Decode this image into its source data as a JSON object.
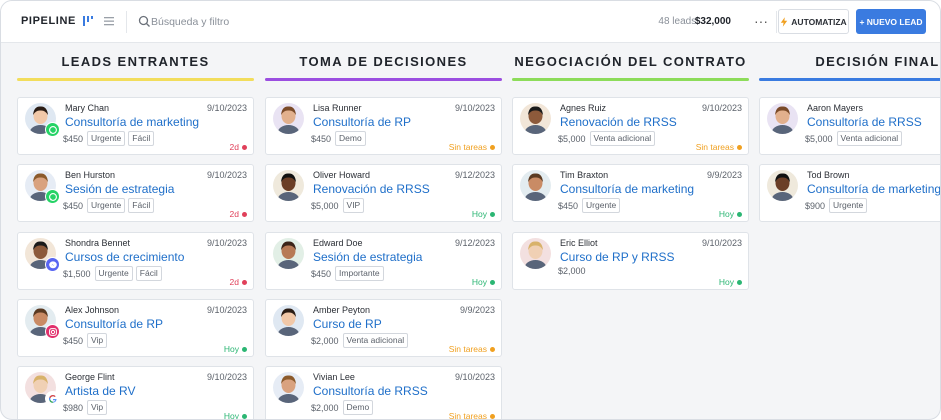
{
  "header": {
    "brand": "PIPELINE",
    "search_placeholder": "Búsqueda y filtro",
    "leads_count": "48 leads:",
    "leads_total": "$32,000",
    "more_label": "···",
    "automate_label": "AUTOMATIZA",
    "new_lead_label": "+ NUEVO LEAD"
  },
  "colors": {
    "accent_blue": "#3a7be0",
    "link_blue": "#1f6fc9",
    "overdue_red": "#e0405a",
    "no_tasks_orange": "#f0a020",
    "today_green": "#2bb673"
  },
  "columns": [
    {
      "title": "LEADS ENTRANTES",
      "color": "#f2dd5c",
      "cards": [
        {
          "name": "Mary Chan",
          "date": "9/10/2023",
          "title": "Consultoría de marketing",
          "price": "$450",
          "tags": [
            "Urgente",
            "Fácil"
          ],
          "status": "2d",
          "status_type": "overdue",
          "source": "whatsapp"
        },
        {
          "name": "Ben Hurston",
          "date": "9/10/2023",
          "title": "Sesión de estrategia",
          "price": "$450",
          "tags": [
            "Urgente",
            "Fácil"
          ],
          "status": "2d",
          "status_type": "overdue",
          "source": "whatsapp"
        },
        {
          "name": "Shondra Bennet",
          "date": "9/10/2023",
          "title": "Cursos de crecimiento",
          "price": "$1,500",
          "tags": [
            "Urgente",
            "Fácil"
          ],
          "status": "2d",
          "status_type": "overdue",
          "source": "messenger"
        },
        {
          "name": "Alex Johnson",
          "date": "9/10/2023",
          "title": "Consultoría de RP",
          "price": "$450",
          "tags": [
            "Vip"
          ],
          "status": "Hoy",
          "status_type": "today",
          "source": "instagram"
        },
        {
          "name": "George Flint",
          "date": "9/10/2023",
          "title": "Artista de RV",
          "price": "$980",
          "tags": [
            "Vip"
          ],
          "status": "Hoy",
          "status_type": "today",
          "source": "google"
        }
      ]
    },
    {
      "title": "TOMA DE DECISIONES",
      "color": "#9b4ee0",
      "cards": [
        {
          "name": "Lisa Runner",
          "date": "9/10/2023",
          "title": "Consultoría de RP",
          "price": "$450",
          "tags": [
            "Demo"
          ],
          "status": "Sin tareas",
          "status_type": "notasks",
          "source": ""
        },
        {
          "name": "Oliver Howard",
          "date": "9/12/2023",
          "title": "Renovación de RRSS",
          "price": "$5,000",
          "tags": [
            "VIP"
          ],
          "status": "Hoy",
          "status_type": "today",
          "source": ""
        },
        {
          "name": "Edward Doe",
          "date": "9/12/2023",
          "title": "Sesión de estrategia",
          "price": "$450",
          "tags": [
            "Importante"
          ],
          "status": "Hoy",
          "status_type": "today",
          "source": ""
        },
        {
          "name": "Amber Peyton",
          "date": "9/9/2023",
          "title": "Curso de RP",
          "price": "$2,000",
          "tags": [
            "Venta adicional"
          ],
          "status": "Sin tareas",
          "status_type": "notasks",
          "source": ""
        },
        {
          "name": "Vivian Lee",
          "date": "9/10/2023",
          "title": "Consultoría de RRSS",
          "price": "$2,000",
          "tags": [
            "Demo"
          ],
          "status": "Sin tareas",
          "status_type": "notasks",
          "source": ""
        }
      ]
    },
    {
      "title": "NEGOCIACIÓN DEL CONTRATO",
      "color": "#8ddc5a",
      "cards": [
        {
          "name": "Agnes Ruiz",
          "date": "9/10/2023",
          "title": "Renovación de RRSS",
          "price": "$5,000",
          "tags": [
            "Venta adicional"
          ],
          "status": "Sin tareas",
          "status_type": "notasks",
          "source": ""
        },
        {
          "name": "Tim Braxton",
          "date": "9/9/2023",
          "title": "Consultoría de marketing",
          "price": "$450",
          "tags": [
            "Urgente"
          ],
          "status": "Hoy",
          "status_type": "today",
          "source": ""
        },
        {
          "name": "Eric Elliot",
          "date": "9/10/2023",
          "title": "Curso de RP y RRSS",
          "price": "$2,000",
          "tags": [],
          "status": "Hoy",
          "status_type": "today",
          "source": ""
        }
      ]
    },
    {
      "title": "DECISIÓN FINAL",
      "color": "#3a7be0",
      "cards": [
        {
          "name": "Aaron Mayers",
          "date": "",
          "title": "Consultoría de RRSS",
          "price": "$5,000",
          "tags": [
            "Venta adicional"
          ],
          "status": "",
          "status_type": "",
          "source": ""
        },
        {
          "name": "Tod Brown",
          "date": "",
          "title": "Consultoría de marketing",
          "price": "$900",
          "tags": [
            "Urgente"
          ],
          "status": "",
          "status_type": "",
          "source": ""
        }
      ]
    }
  ]
}
